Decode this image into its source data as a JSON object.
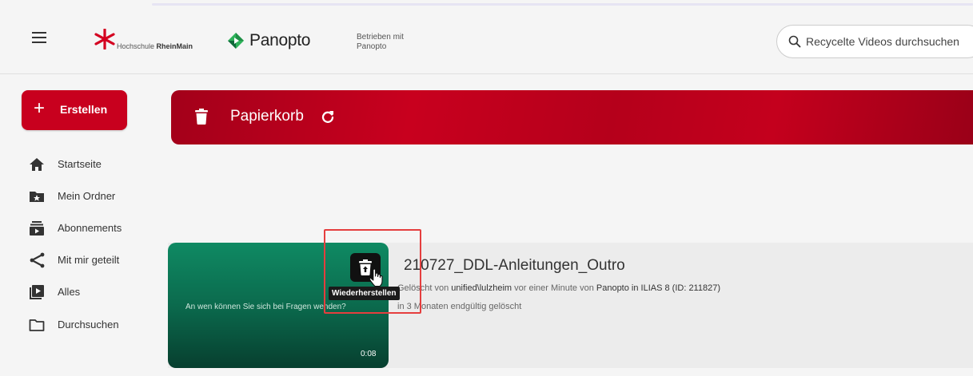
{
  "header": {
    "university_logo_text_prefix": "Hochschule ",
    "university_logo_text_bold": "RheinMain",
    "product_name": "Panopto",
    "powered_by_line1": "Betrieben mit",
    "powered_by_line2": "Panopto",
    "search_placeholder": "Recycelte Videos durchsuchen"
  },
  "sidebar": {
    "create_label": "Erstellen",
    "items": [
      {
        "label": "Startseite",
        "icon": "home-icon"
      },
      {
        "label": "Mein Ordner",
        "icon": "star-folder-icon"
      },
      {
        "label": "Abonnements",
        "icon": "subscriptions-icon"
      },
      {
        "label": "Mit mir geteilt",
        "icon": "share-icon"
      },
      {
        "label": "Alles",
        "icon": "playlist-icon"
      },
      {
        "label": "Durchsuchen",
        "icon": "folder-icon"
      }
    ]
  },
  "banner": {
    "title": "Papierkorb"
  },
  "video": {
    "title": "210727_DDL-Anleitungen_Outro",
    "thumbnail_text": "An wen können Sie sich bei Fragen wenden?",
    "duration": "0:08",
    "meta_prefix": "Gelöscht von ",
    "meta_user": "unified\\lulzheim",
    "meta_middle": " vor einer Minute von ",
    "meta_source": "Panopto in ILIAS 8 (ID: 211827)",
    "expire": "in 3 Monaten endgültig gelöscht",
    "restore_tooltip": "Wiederherstellen"
  },
  "colors": {
    "brand_red": "#c8001e",
    "thumbnail_green": "#0b6a4d",
    "highlight": "#e53e3e"
  }
}
